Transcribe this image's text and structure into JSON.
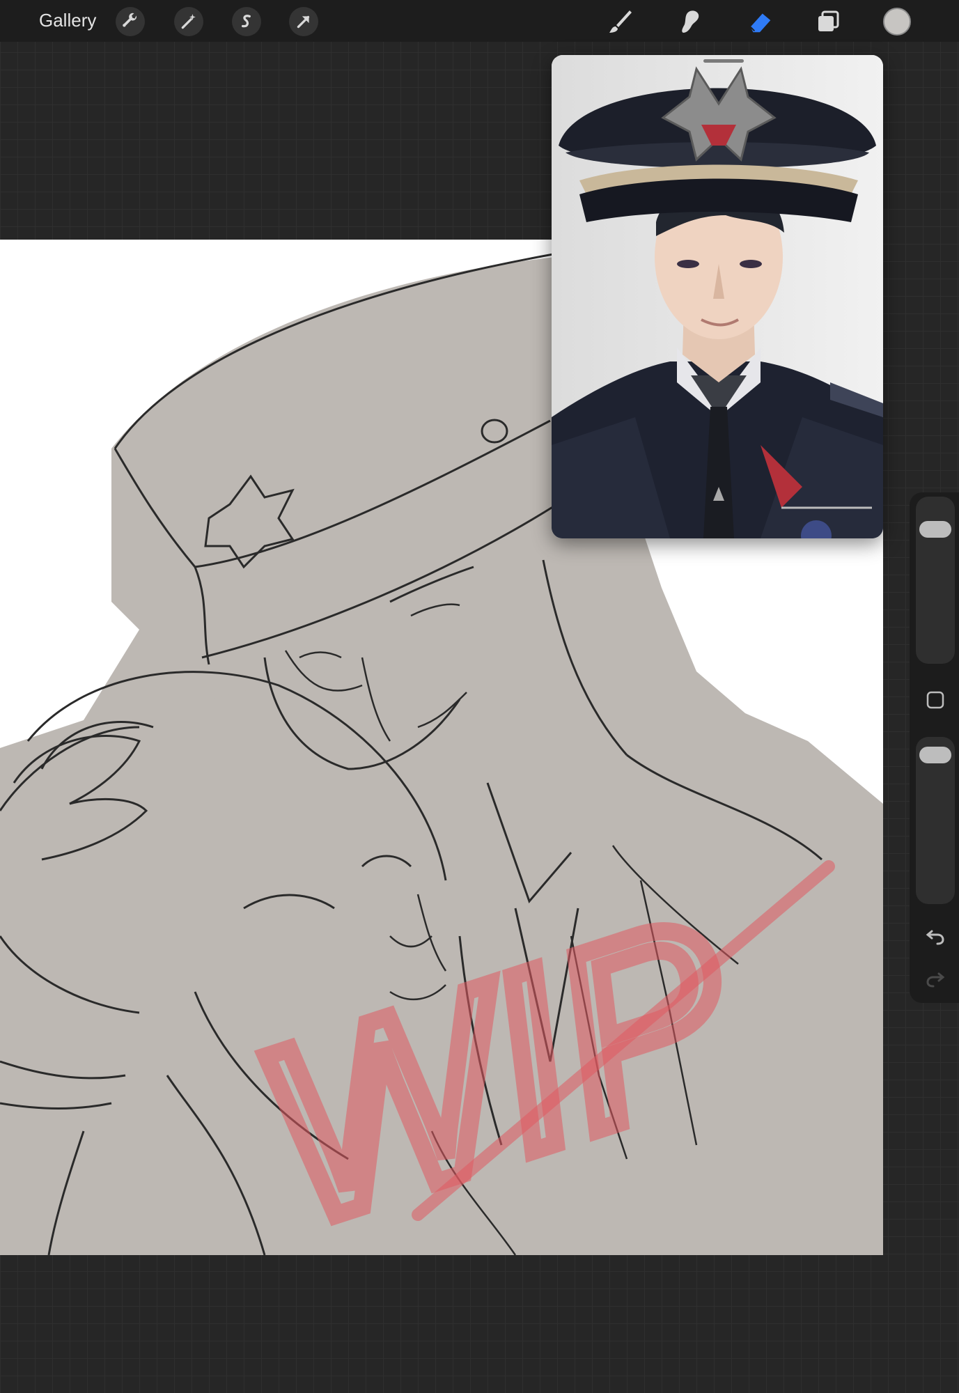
{
  "app": {
    "gallery_label": "Gallery"
  },
  "toolbar_left": [
    {
      "name": "actions-wrench-icon"
    },
    {
      "name": "adjustments-magic-wand-icon"
    },
    {
      "name": "selection-s-icon"
    },
    {
      "name": "transform-arrow-icon"
    }
  ],
  "toolbar_right": [
    {
      "name": "brush-icon",
      "active": false
    },
    {
      "name": "smudge-icon",
      "active": false
    },
    {
      "name": "eraser-icon",
      "active": true
    },
    {
      "name": "layers-icon",
      "active": false
    }
  ],
  "colors": {
    "active_tool": "#2f7bf6",
    "current_color": "#c7c5c2",
    "canvas_fill": "#bdb8b3",
    "watermark": "#e05a60"
  },
  "canvas": {
    "watermark_text": "WIP"
  },
  "sidebar": {
    "brush_size_level": 0.15,
    "brush_opacity_level": 0.05
  }
}
